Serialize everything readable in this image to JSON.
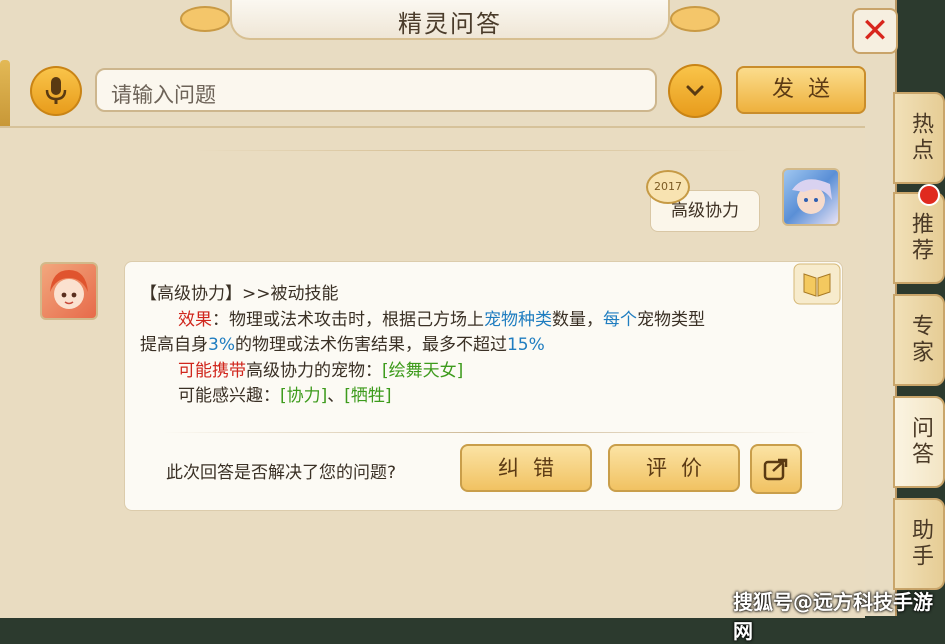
{
  "window": {
    "title": "精灵问答",
    "close_icon": "close-icon"
  },
  "search": {
    "placeholder": "请输入问题",
    "send_label": "发送"
  },
  "user_message": {
    "text": "高级协力",
    "badge": "2017"
  },
  "answer": {
    "line1": "【高级协力】>>被动技能",
    "effect_label": "效果",
    "line2_a": "：物理或法术攻击时，根据己方场上",
    "line2_highlight1": "宠物种类",
    "line2_b": "数量，",
    "line2_highlight2": "每个",
    "line2_c": "宠物类型",
    "line3_a": "提高自身",
    "line3_pct1": "3%",
    "line3_b": "的物理或法术伤害结果，最多不超过",
    "line3_pct2": "15%",
    "carry_label": "可能携带",
    "carry_text": "高级协力的宠物：",
    "carry_pet": "[绘舞天女]",
    "interest_label": "可能感兴趣：",
    "interest_1": "[协力]",
    "interest_sep": "、",
    "interest_2": "[牺牲]"
  },
  "feedback": {
    "question": "此次回答是否解决了您的问题?",
    "error_label": "纠错",
    "rate_label": "评价"
  },
  "side_tabs": [
    {
      "label": "热点"
    },
    {
      "label": "推荐"
    },
    {
      "label": "专家"
    },
    {
      "label": "问答"
    },
    {
      "label": "助手"
    }
  ],
  "watermark": "搜狐号@远方科技手游网",
  "colors": {
    "accent": "#f1c262",
    "highlight_red": "#d0261c",
    "highlight_blue": "#1f7dc0",
    "highlight_green": "#3d9b1c"
  }
}
